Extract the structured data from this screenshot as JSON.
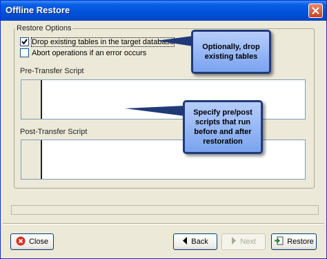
{
  "window": {
    "title": "Offline Restore"
  },
  "restore_options": {
    "legend": "Restore Options",
    "drop_tables": {
      "label": "Drop existing tables in the target database",
      "checked": true
    },
    "abort_on_error": {
      "label": "Abort operations if an error occurs",
      "checked": false
    }
  },
  "pre_transfer": {
    "label": "Pre-Transfer Script"
  },
  "post_transfer": {
    "label": "Post-Transfer Script"
  },
  "buttons": {
    "close": "Close",
    "back": "Back",
    "next": "Next",
    "restore": "Restore"
  },
  "callouts": {
    "drop_tables": "Optionally, drop existing tables",
    "scripts": "Specify pre/post scripts that run before and after restoration"
  },
  "colors": {
    "titlebar": "#0150d8",
    "callout_border": "#203a78",
    "callout_fill": "#9dbcf5"
  },
  "icons": {
    "close": "red-x-icon",
    "back": "left-arrow-icon",
    "next": "right-arrow-icon",
    "restore": "restore-arrow-icon"
  }
}
